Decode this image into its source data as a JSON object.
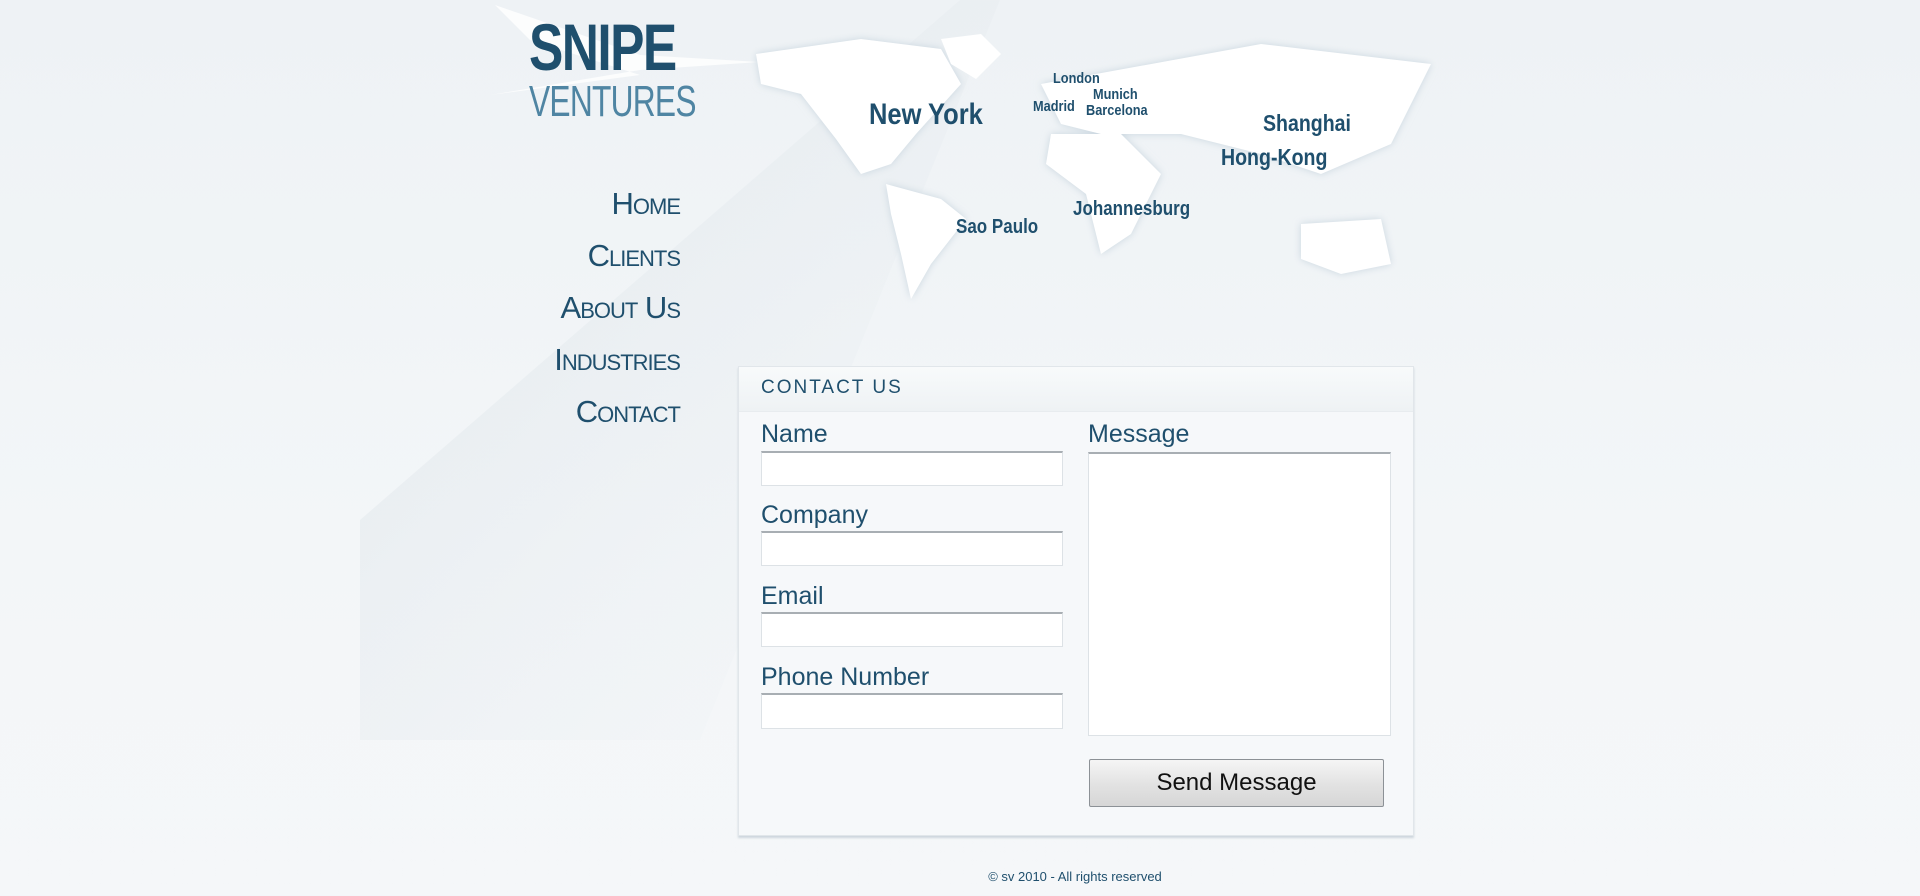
{
  "logo": {
    "line1": "SNIPE",
    "line2": "VENTURES"
  },
  "nav": {
    "items": [
      {
        "label": "Home"
      },
      {
        "label": "Clients"
      },
      {
        "label": "About Us"
      },
      {
        "label": "Industries"
      },
      {
        "label": "Contact"
      }
    ]
  },
  "map": {
    "cities": [
      "New York",
      "London",
      "Munich",
      "Madrid",
      "Barcelona",
      "Shanghai",
      "Hong-Kong",
      "Sao Paulo",
      "Johannesburg"
    ]
  },
  "contact": {
    "title": "CONTACT US",
    "fields": [
      {
        "label": "Name",
        "value": ""
      },
      {
        "label": "Company",
        "value": ""
      },
      {
        "label": "Email",
        "value": ""
      },
      {
        "label": "Phone Number",
        "value": ""
      }
    ],
    "message": {
      "label": "Message",
      "value": ""
    },
    "submit_label": "Send Message"
  },
  "footer": {
    "text": "© sv 2010 - All rights reserved"
  },
  "colors": {
    "brand": "#1f4f6d",
    "brand_light": "#4f85a3",
    "background": "#eef2f5"
  }
}
